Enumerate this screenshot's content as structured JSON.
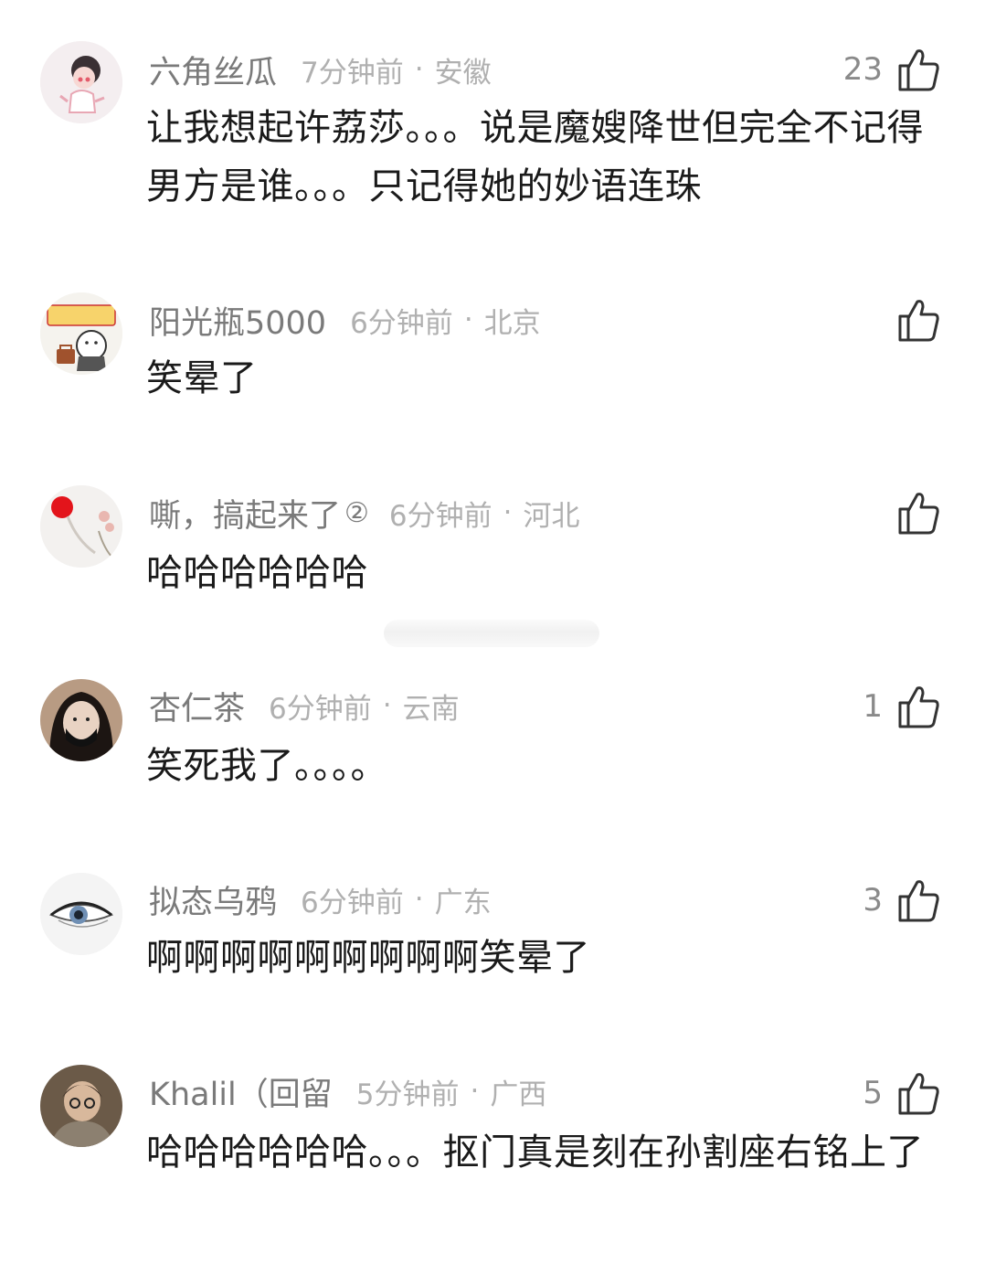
{
  "comments": [
    {
      "username": "六角丝瓜",
      "time": "7分钟前",
      "dot": "·",
      "location": "安徽",
      "badge": "",
      "likes": "23",
      "text": "让我想起许荔莎。。。说是魔嫂降世但完全不记得男方是谁。。。只记得她的妙语连珠"
    },
    {
      "username": "阳光瓶5000",
      "time": "6分钟前",
      "dot": "·",
      "location": "北京",
      "badge": "",
      "likes": "",
      "text": "笑晕了"
    },
    {
      "username": "嘶，搞起来了",
      "time": "6分钟前",
      "dot": "·",
      "location": "河北",
      "badge": "②",
      "likes": "",
      "text": "哈哈哈哈哈哈"
    },
    {
      "username": "杏仁茶",
      "time": "6分钟前",
      "dot": "·",
      "location": "云南",
      "badge": "",
      "likes": "1",
      "text": "笑死我了。。。。"
    },
    {
      "username": "拟态乌鸦",
      "time": "6分钟前",
      "dot": "·",
      "location": "广东",
      "badge": "",
      "likes": "3",
      "text": "啊啊啊啊啊啊啊啊啊笑晕了"
    },
    {
      "username": "Khalil（回留",
      "time": "5分钟前",
      "dot": "·",
      "location": "广西",
      "badge": "",
      "likes": "5",
      "text": "哈哈哈哈哈哈。。。抠门真是刻在孙割座右铭上了"
    }
  ],
  "icons": {
    "like": "thumbs-up-icon"
  },
  "colors": {
    "username": "#7a7a7a",
    "meta": "#b0b0b0",
    "text": "#1a1a1a",
    "icon_stroke": "#333333"
  }
}
